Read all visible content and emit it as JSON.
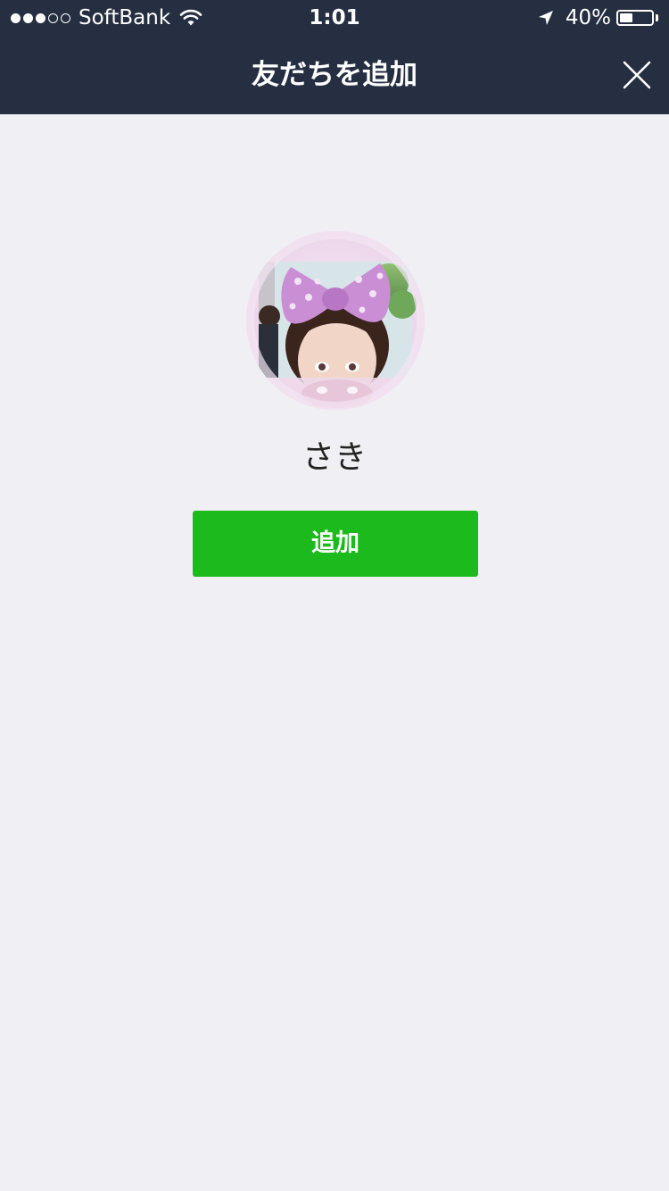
{
  "status_bar": {
    "carrier": "SoftBank",
    "time": "1:01",
    "battery_percent": "40%",
    "battery_level": 0.4,
    "signal_bars_filled": 3,
    "signal_bars_total": 5
  },
  "nav": {
    "title": "友だちを追加",
    "close_icon": "close-icon"
  },
  "profile": {
    "name": "さき",
    "avatar_icon": "avatar-photo"
  },
  "actions": {
    "add_label": "追加"
  },
  "colors": {
    "header_bg": "#262f42",
    "page_bg": "#efeff4",
    "add_button": "#1cba1c"
  }
}
